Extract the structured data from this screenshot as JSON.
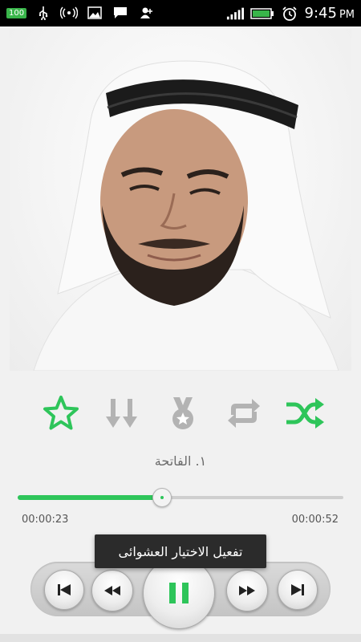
{
  "status_bar": {
    "battery_badge": "100",
    "time": "9:45",
    "ampm": "PM",
    "colors": {
      "background": "#000000",
      "battery": "#39b54a"
    }
  },
  "artwork": {
    "icon": "reciter-photo"
  },
  "controls": [
    {
      "name": "favorite",
      "icon": "star-icon",
      "active": true
    },
    {
      "name": "download",
      "icon": "download-icon",
      "active": false
    },
    {
      "name": "award",
      "icon": "medal-icon",
      "active": false
    },
    {
      "name": "repeat",
      "icon": "repeat-icon",
      "active": false
    },
    {
      "name": "shuffle",
      "icon": "shuffle-icon",
      "active": true
    }
  ],
  "track": {
    "title": "١. الفاتحة"
  },
  "progress": {
    "elapsed": "00:00:23",
    "total": "00:00:52",
    "fraction": 0.44
  },
  "toast": {
    "text": "تفعيل الاختيار العشوائى"
  },
  "player": {
    "buttons": [
      "previous-track",
      "rewind",
      "pause",
      "fast-forward",
      "next-track"
    ]
  },
  "theme": {
    "accent": "#2ec55a",
    "inactive": "#b3b3b3",
    "text": "#555555"
  }
}
